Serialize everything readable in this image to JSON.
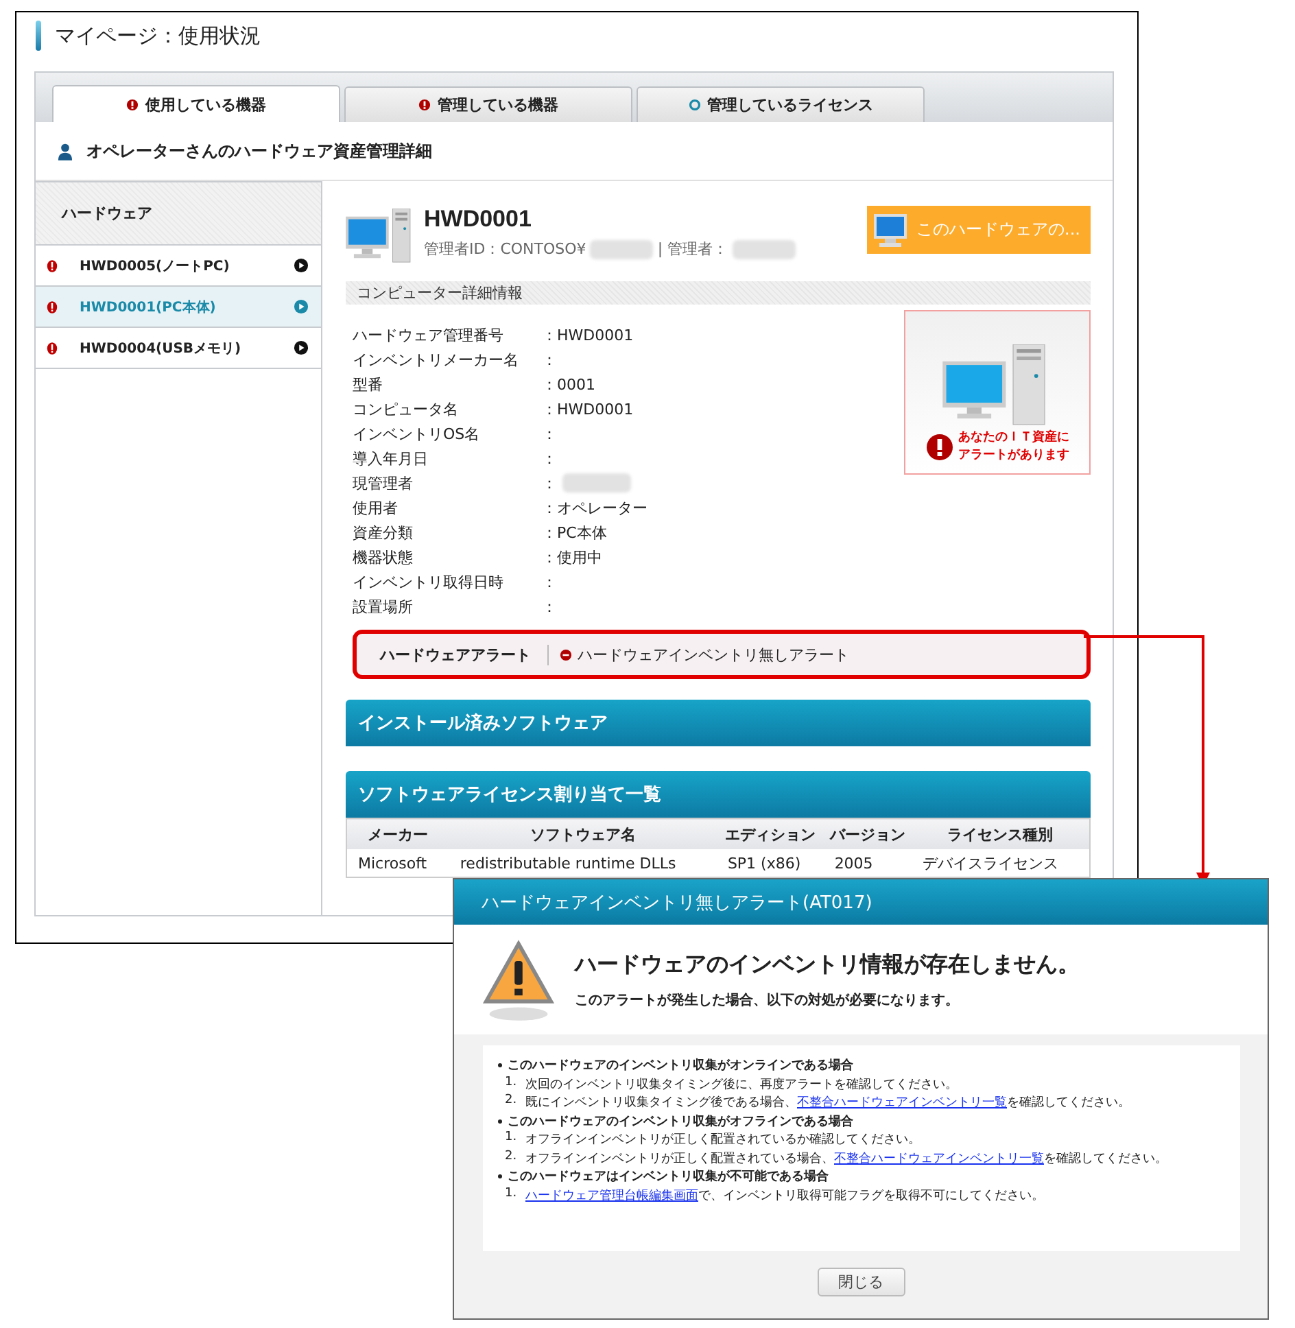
{
  "page_title": "マイページ：使用状況",
  "tabs": [
    {
      "label": "使用している機器",
      "selected": true,
      "alert": true
    },
    {
      "label": "管理している機器",
      "selected": false,
      "alert": true
    },
    {
      "label": "管理しているライセンス",
      "selected": false,
      "alert": false
    }
  ],
  "heading": "オペレーターさんのハードウェア資産管理詳細",
  "sidebar": {
    "title": "ハードウェア",
    "items": [
      {
        "label": "HWD0005(ノートPC)",
        "selected": false,
        "alert": true
      },
      {
        "label": "HWD0001(PC本体)",
        "selected": true,
        "alert": true
      },
      {
        "label": "HWD0004(USBメモリ)",
        "selected": false,
        "alert": true
      }
    ]
  },
  "hardware": {
    "name": "HWD0001",
    "admin_id_label": "管理者ID：CONTOSO¥",
    "manager_label": "| 管理者：",
    "action_button": "このハードウェアの..."
  },
  "details": {
    "title": "コンピューター詳細情報",
    "rows": [
      {
        "label": "ハードウェア管理番号",
        "value": "：HWD0001"
      },
      {
        "label": "インベントリメーカー名",
        "value": "："
      },
      {
        "label": "型番",
        "value": "：0001"
      },
      {
        "label": "コンピュータ名",
        "value": "：HWD0001"
      },
      {
        "label": "インベントリOS名",
        "value": "："
      },
      {
        "label": "導入年月日",
        "value": "："
      },
      {
        "label": "現管理者",
        "value": "：",
        "redacted": true
      },
      {
        "label": "使用者",
        "value": "：オペレーター"
      },
      {
        "label": "資産分類",
        "value": "：PC本体"
      },
      {
        "label": "機器状態",
        "value": "：使用中"
      },
      {
        "label": "インベントリ取得日時",
        "value": "："
      },
      {
        "label": "設置場所",
        "value": "："
      }
    ]
  },
  "alert_banner": {
    "line_1": "あなたのＩＴ資産に",
    "line_2": "アラートがあります"
  },
  "hardware_alert": {
    "label": "ハードウェアアラート",
    "value": "ハードウェアインベントリ無しアラート"
  },
  "installed_software": {
    "title": "インストール済みソフトウェア"
  },
  "license_table": {
    "title": "ソフトウェアライセンス割り当て一覧",
    "columns": [
      "メーカー",
      "ソフトウェア名",
      "エディション",
      "バージョン",
      "ライセンス種別"
    ],
    "rows": [
      [
        "Microsoft",
        "redistributable runtime DLLs",
        "SP1 (x86)",
        "2005",
        "デバイスライセンス"
      ]
    ]
  },
  "dialog": {
    "title": "ハードウェアインベントリ無しアラート(AT017)",
    "headline": "ハードウェアのインベントリ情報が存在しません。",
    "subline": "このアラートが発生した場合、以下の対処が必要になります。",
    "sections": [
      {
        "title": "このハードウェアのインベントリ収集がオンラインである場合",
        "steps": [
          {
            "number": "1.",
            "text": "次回のインベントリ収集タイミング後に、再度アラートを確認してください。"
          },
          {
            "number": "2.",
            "text": "既にインベントリ収集タイミング後である場合、",
            "link": "不整合ハードウェアインベントリ一覧",
            "after": "を確認してください。"
          }
        ]
      },
      {
        "title": "このハードウェアのインベントリ収集がオフラインである場合",
        "steps": [
          {
            "number": "1.",
            "text": "オフラインインベントリが正しく配置されているか確認してください。"
          },
          {
            "number": "2.",
            "text": "オフラインインベントリが正しく配置されている場合、",
            "link": "不整合ハードウェアインベントリ一覧",
            "after": "を確認してください。"
          }
        ]
      },
      {
        "title": "このハードウェアはインベントリ収集が不可能である場合",
        "steps": [
          {
            "number": "1.",
            "link": "ハードウェア管理台帳編集画面",
            "after": "で、インベントリ取得可能フラグを取得不可にしてください。"
          }
        ]
      }
    ],
    "close_button": "閉じる"
  }
}
